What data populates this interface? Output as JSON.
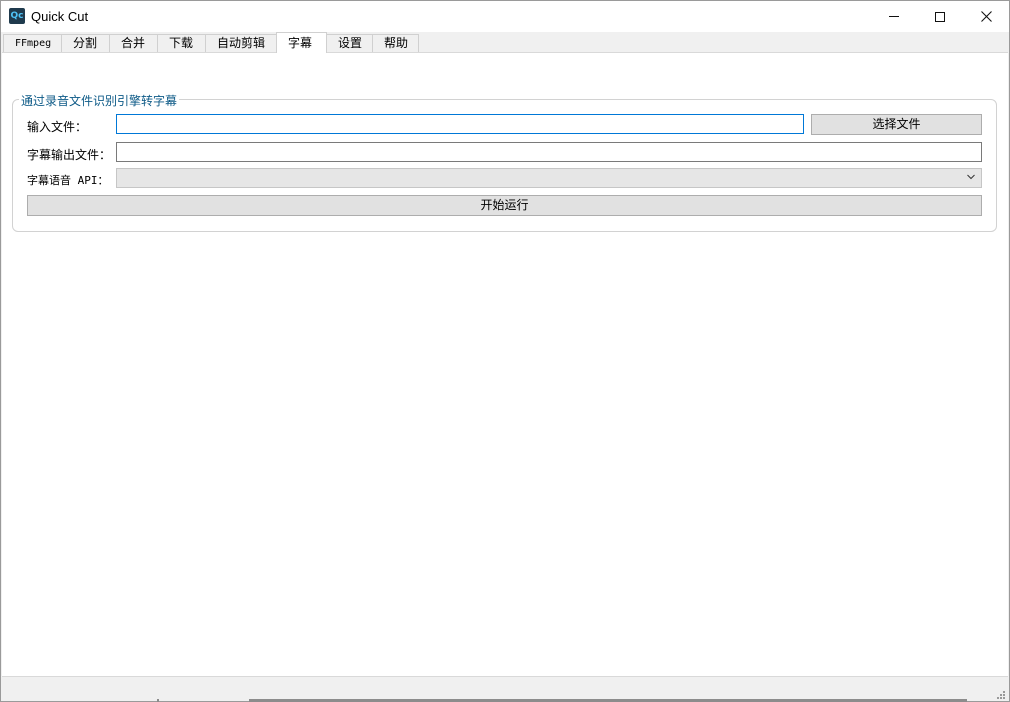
{
  "window": {
    "title": "Quick Cut",
    "icon_text": "Qc",
    "controls": [
      "minimize-icon",
      "maximize-icon",
      "close-icon"
    ]
  },
  "tabs": [
    {
      "label": "FFmpeg",
      "active": false
    },
    {
      "label": "分割",
      "active": false
    },
    {
      "label": "合并",
      "active": false
    },
    {
      "label": "下载",
      "active": false
    },
    {
      "label": "自动剪辑",
      "active": false
    },
    {
      "label": "字幕",
      "active": true
    },
    {
      "label": "设置",
      "active": false
    },
    {
      "label": "帮助",
      "active": false
    }
  ],
  "subtitle_panel": {
    "group_title": "通过录音文件识别引擎转字幕",
    "input_file": {
      "label": "输入文件：",
      "value": "",
      "placeholder": ""
    },
    "choose_file_button": "选择文件",
    "output_file": {
      "label": "字幕输出文件：",
      "value": "",
      "placeholder": ""
    },
    "api_select": {
      "label": "字幕语音 API：",
      "selected": ""
    },
    "run_button": "开始运行"
  },
  "colors": {
    "accent": "#0078d7",
    "group_title": "#0d5a87",
    "panel_bg": "#ffffff",
    "window_bg": "#f0f0f0"
  }
}
